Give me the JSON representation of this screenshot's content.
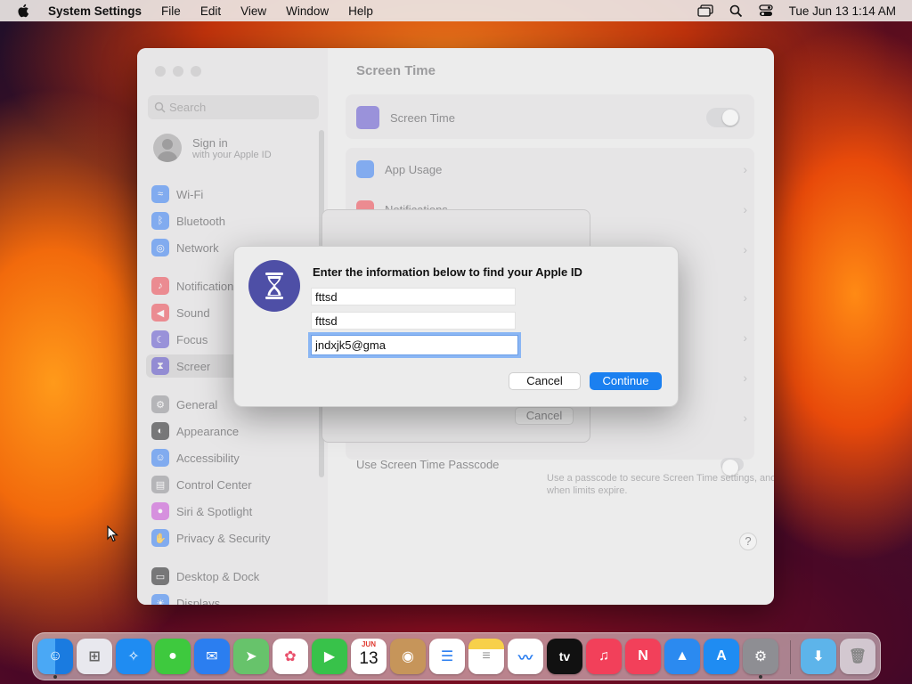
{
  "menubar": {
    "app_name": "System Settings",
    "menus": [
      "File",
      "Edit",
      "View",
      "Window",
      "Help"
    ],
    "clock": "Tue Jun 13  1:14 AM"
  },
  "sidebar": {
    "search_placeholder": "Search",
    "signin_title": "Sign in",
    "signin_subtitle": "with your Apple ID",
    "items": [
      {
        "label": "Wi-Fi",
        "color": "#2f7cf6"
      },
      {
        "label": "Bluetooth",
        "color": "#2f7cf6"
      },
      {
        "label": "Network",
        "color": "#2f7cf6"
      },
      {
        "label": "Notifications",
        "color": "#f0424b"
      },
      {
        "label": "Sound",
        "color": "#f0424b"
      },
      {
        "label": "Focus",
        "color": "#5b4fcf"
      },
      {
        "label": "Screen Time",
        "color": "#5b4fcf"
      },
      {
        "label": "General",
        "color": "#8e8e93"
      },
      {
        "label": "Appearance",
        "color": "#1d1d1f"
      },
      {
        "label": "Accessibility",
        "color": "#2f7cf6"
      },
      {
        "label": "Control Center",
        "color": "#8e8e93"
      },
      {
        "label": "Siri & Spotlight",
        "color": "#c94bd8"
      },
      {
        "label": "Privacy & Security",
        "color": "#2f7cf6"
      },
      {
        "label": "Desktop & Dock",
        "color": "#1d1d1f"
      },
      {
        "label": "Displays",
        "color": "#2f7cf6"
      }
    ]
  },
  "main": {
    "title": "Screen Time",
    "screen_time_label": "Screen Time",
    "app_usage_label": "App Usage",
    "notifications_label": "Notifications",
    "passcode_label": "Use Screen Time Passcode",
    "passcode_desc_1": "Use a passcode to secure Screen Time settings, and to allow for more time",
    "passcode_desc_2": "when limits expire.",
    "sheet_cancel": "Cancel",
    "help": "?"
  },
  "dialog": {
    "title": "Enter the information below to find your Apple ID",
    "first_name": "fttsd",
    "last_name": "fttsd",
    "email": "jndxjk5@gma",
    "cancel": "Cancel",
    "continue": "Continue",
    "accent": "#1b80f0"
  },
  "dock": {
    "calendar_month": "JUN",
    "calendar_day": "13",
    "tv_label": "tv",
    "items": [
      "finder-icon",
      "launchpad-icon",
      "safari-icon",
      "messages-icon",
      "mail-icon",
      "maps-icon",
      "photos-icon",
      "facetime-icon",
      "calendar-icon",
      "contacts-icon",
      "reminders-icon",
      "notes-icon",
      "freeform-icon",
      "apple-tv-icon",
      "music-icon",
      "news-icon",
      "keynote-icon",
      "app-store-icon",
      "system-settings-icon",
      "downloads-folder-icon",
      "trash-icon"
    ]
  }
}
